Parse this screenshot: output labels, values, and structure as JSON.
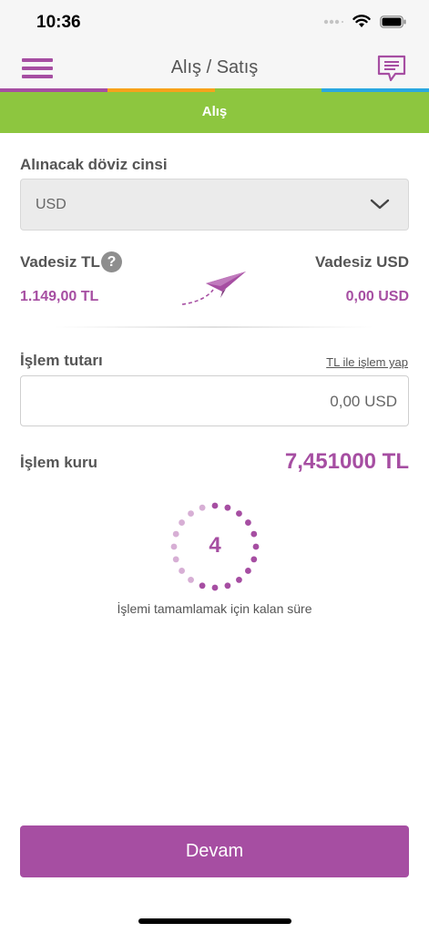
{
  "status_bar": {
    "time": "10:36"
  },
  "nav": {
    "title": "Alış / Satış"
  },
  "colors": {
    "purple": "#a64ea2",
    "green": "#8dc63f",
    "orange": "#f7a21b",
    "blue": "#2aa8e0"
  },
  "tab": {
    "active_label": "Alış"
  },
  "currency": {
    "label": "Alınacak döviz cinsi",
    "selected": "USD"
  },
  "accounts": {
    "from_label": "Vadesiz TL",
    "from_amount": "1.149,00 TL",
    "to_label": "Vadesiz USD",
    "to_amount": "0,00 USD",
    "help_glyph": "?"
  },
  "transaction": {
    "amount_label": "İşlem tutarı",
    "tl_link": "TL ile işlem yap",
    "amount_value": "0,00 USD"
  },
  "rate": {
    "label": "İşlem kuru",
    "value": "7,451000 TL"
  },
  "timer": {
    "seconds_left": "4",
    "caption": "İşlemi tamamlamak için kalan süre",
    "total_dots": 20,
    "active_dots": 12
  },
  "actions": {
    "continue_label": "Devam"
  },
  "icons": [
    "menu-icon",
    "chat-icon",
    "chevron-down-icon",
    "help-icon",
    "paper-plane-icon",
    "wifi-icon",
    "battery-icon",
    "signal-icon"
  ]
}
